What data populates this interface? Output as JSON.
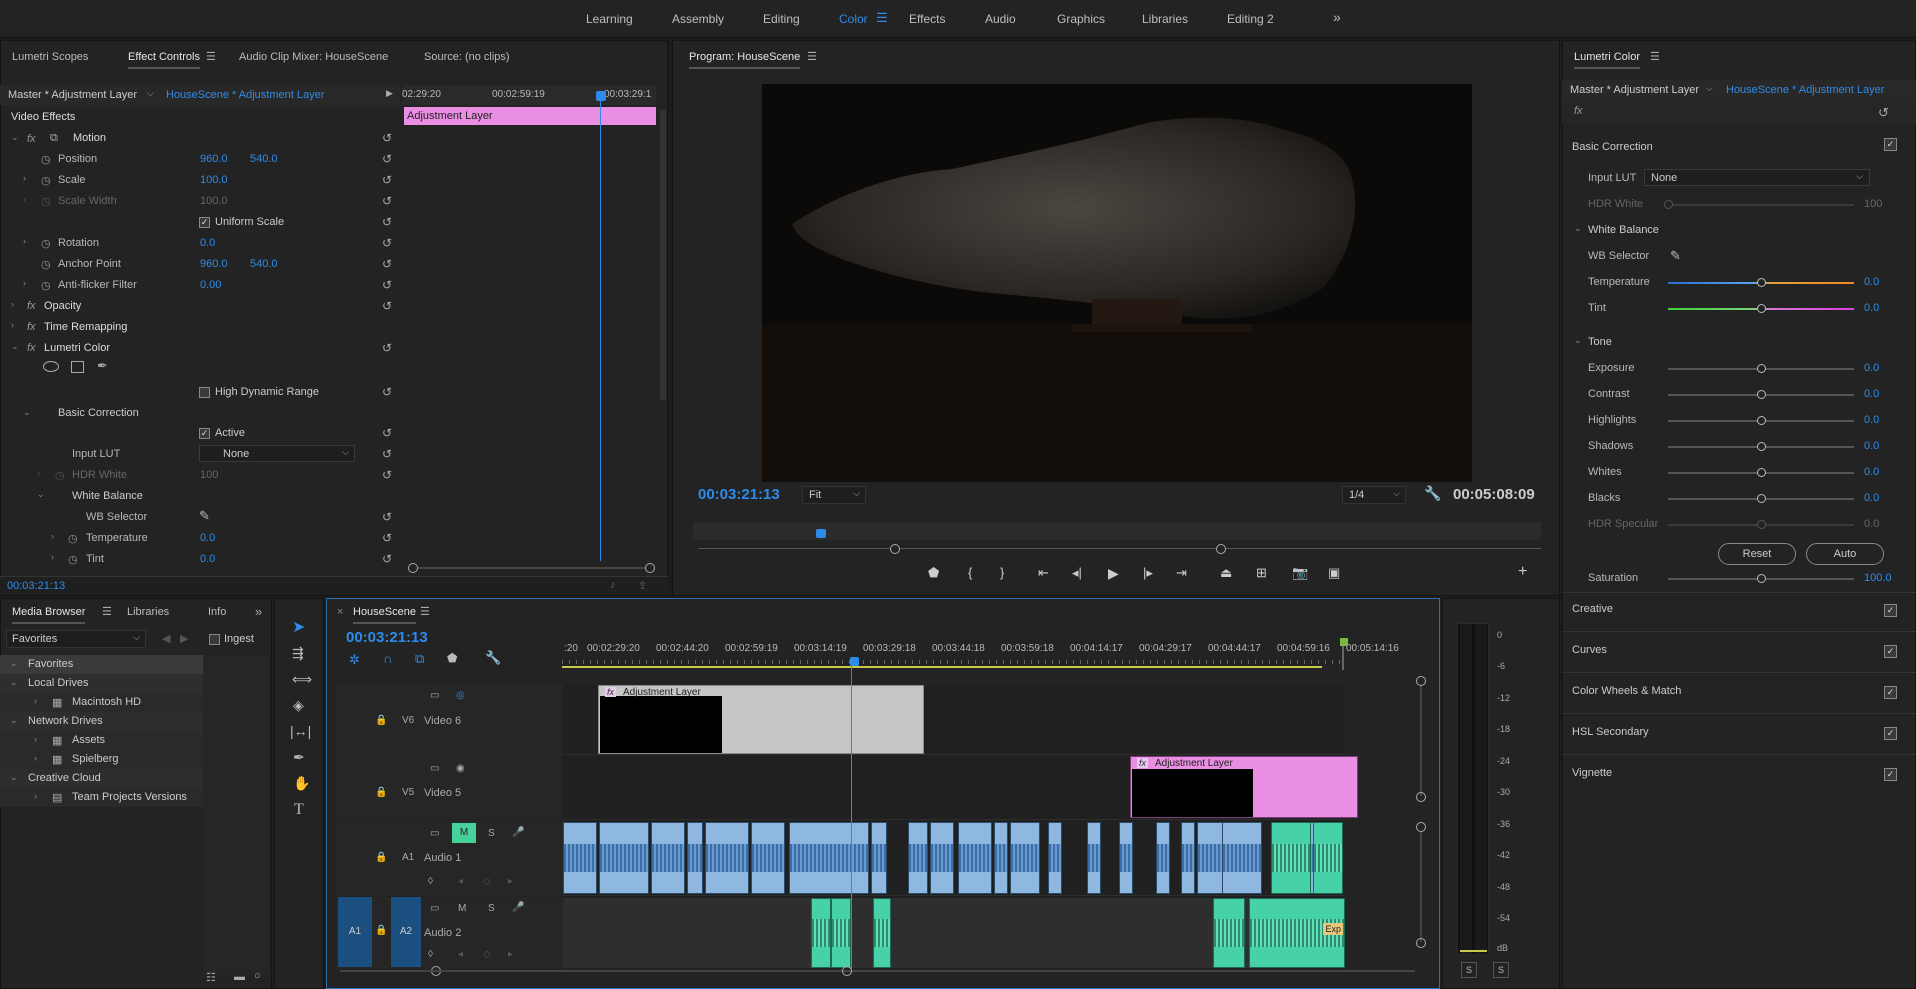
{
  "workspaces": [
    "Learning",
    "Assembly",
    "Editing",
    "Color",
    "Effects",
    "Audio",
    "Graphics",
    "Libraries",
    "Editing 2"
  ],
  "active_workspace": "Color",
  "effect_panel": {
    "tabs": [
      "Lumetri Scopes",
      "Effect Controls",
      "Audio Clip Mixer: HouseScene",
      "Source: (no clips)"
    ],
    "master_label": "Master * Adjustment Layer",
    "clip_label": "HouseScene * Adjustment Layer",
    "ruler_times": [
      "02:29:20",
      "00:02:59:19",
      "00:03:29:1"
    ],
    "clip_bar": "Adjustment Layer",
    "section": "Video Effects",
    "motion": "Motion",
    "position": "Position",
    "position_x": "960.0",
    "position_y": "540.0",
    "scale": "Scale",
    "scale_val": "100.0",
    "scale_width": "Scale Width",
    "scale_width_val": "100.0",
    "uniform_scale": "Uniform Scale",
    "rotation": "Rotation",
    "rotation_val": "0.0",
    "anchor_point": "Anchor Point",
    "anchor_x": "960.0",
    "anchor_y": "540.0",
    "antiflicker": "Anti-flicker Filter",
    "antiflicker_val": "0.00",
    "opacity": "Opacity",
    "time_remapping": "Time Remapping",
    "lumetri": "Lumetri Color",
    "hdr": "High Dynamic Range",
    "basic_correction": "Basic Correction",
    "active": "Active",
    "input_lut": "Input LUT",
    "input_lut_val": "None",
    "hdr_white": "HDR White",
    "hdr_white_val": "100",
    "white_balance": "White Balance",
    "wb_selector": "WB Selector",
    "temperature": "Temperature",
    "temperature_val": "0.0",
    "tint": "Tint",
    "tint_val": "0.0",
    "timecode": "00:03:21:13"
  },
  "program": {
    "title": "Program: HouseScene",
    "timecode": "00:03:21:13",
    "fit": "Fit",
    "resolution": "1/4",
    "duration": "00:05:08:09"
  },
  "lumetri": {
    "title": "Lumetri Color",
    "master_label": "Master * Adjustment Layer",
    "clip_label": "HouseScene * Adjustment Layer",
    "fx": "fx",
    "basic_correction": "Basic Correction",
    "input_lut": "Input LUT",
    "input_lut_val": "None",
    "hdr_white": "HDR White",
    "hdr_white_val": "100",
    "white_balance": "White Balance",
    "wb_selector": "WB Selector",
    "temperature": "Temperature",
    "temperature_val": "0.0",
    "tint": "Tint",
    "tint_val": "0.0",
    "tone": "Tone",
    "exposure": "Exposure",
    "exposure_val": "0.0",
    "contrast": "Contrast",
    "contrast_val": "0.0",
    "highlights": "Highlights",
    "highlights_val": "0.0",
    "shadows": "Shadows",
    "shadows_val": "0.0",
    "whites": "Whites",
    "whites_val": "0.0",
    "blacks": "Blacks",
    "blacks_val": "0.0",
    "hdr_specular": "HDR Specular",
    "hdr_specular_val": "0.0",
    "reset": "Reset",
    "auto": "Auto",
    "saturation": "Saturation",
    "saturation_val": "100.0",
    "creative": "Creative",
    "curves": "Curves",
    "color_wheels": "Color Wheels & Match",
    "hsl": "HSL Secondary",
    "vignette": "Vignette"
  },
  "media": {
    "tabs": [
      "Media Browser",
      "Libraries",
      "Info"
    ],
    "favorites_select": "Favorites",
    "ingest": "Ingest",
    "tree": [
      "Favorites",
      "Local Drives",
      "Macintosh HD",
      "Network Drives",
      "Assets",
      "Spielberg",
      "Creative Cloud",
      "Team Projects Versions"
    ]
  },
  "timeline": {
    "title": "HouseScene",
    "timecode": "00:03:21:13",
    "ruler": [
      ":20",
      "00:02:29:20",
      "00:02:44:20",
      "00:02:59:19",
      "00:03:14:19",
      "00:03:29:18",
      "00:03:44:18",
      "00:03:59:18",
      "00:04:14:17",
      "00:04:29:17",
      "00:04:44:17",
      "00:04:59:16",
      "00:05:14:16"
    ],
    "v6": "V6",
    "video6": "Video 6",
    "v5": "V5",
    "video5": "Video 5",
    "a1": "A1",
    "audio1": "Audio 1",
    "a2": "A2",
    "audio2": "Audio 2",
    "src_a1": "A1",
    "m": "M",
    "s": "S",
    "adj1": "Adjustment Layer",
    "adj2": "Adjustment Layer",
    "exp": "Exp"
  },
  "meter": {
    "scale": [
      "0",
      "-6",
      "-12",
      "-18",
      "-24",
      "-30",
      "-36",
      "-42",
      "-48",
      "-54",
      "dB"
    ],
    "solo": [
      "S",
      "S"
    ]
  }
}
